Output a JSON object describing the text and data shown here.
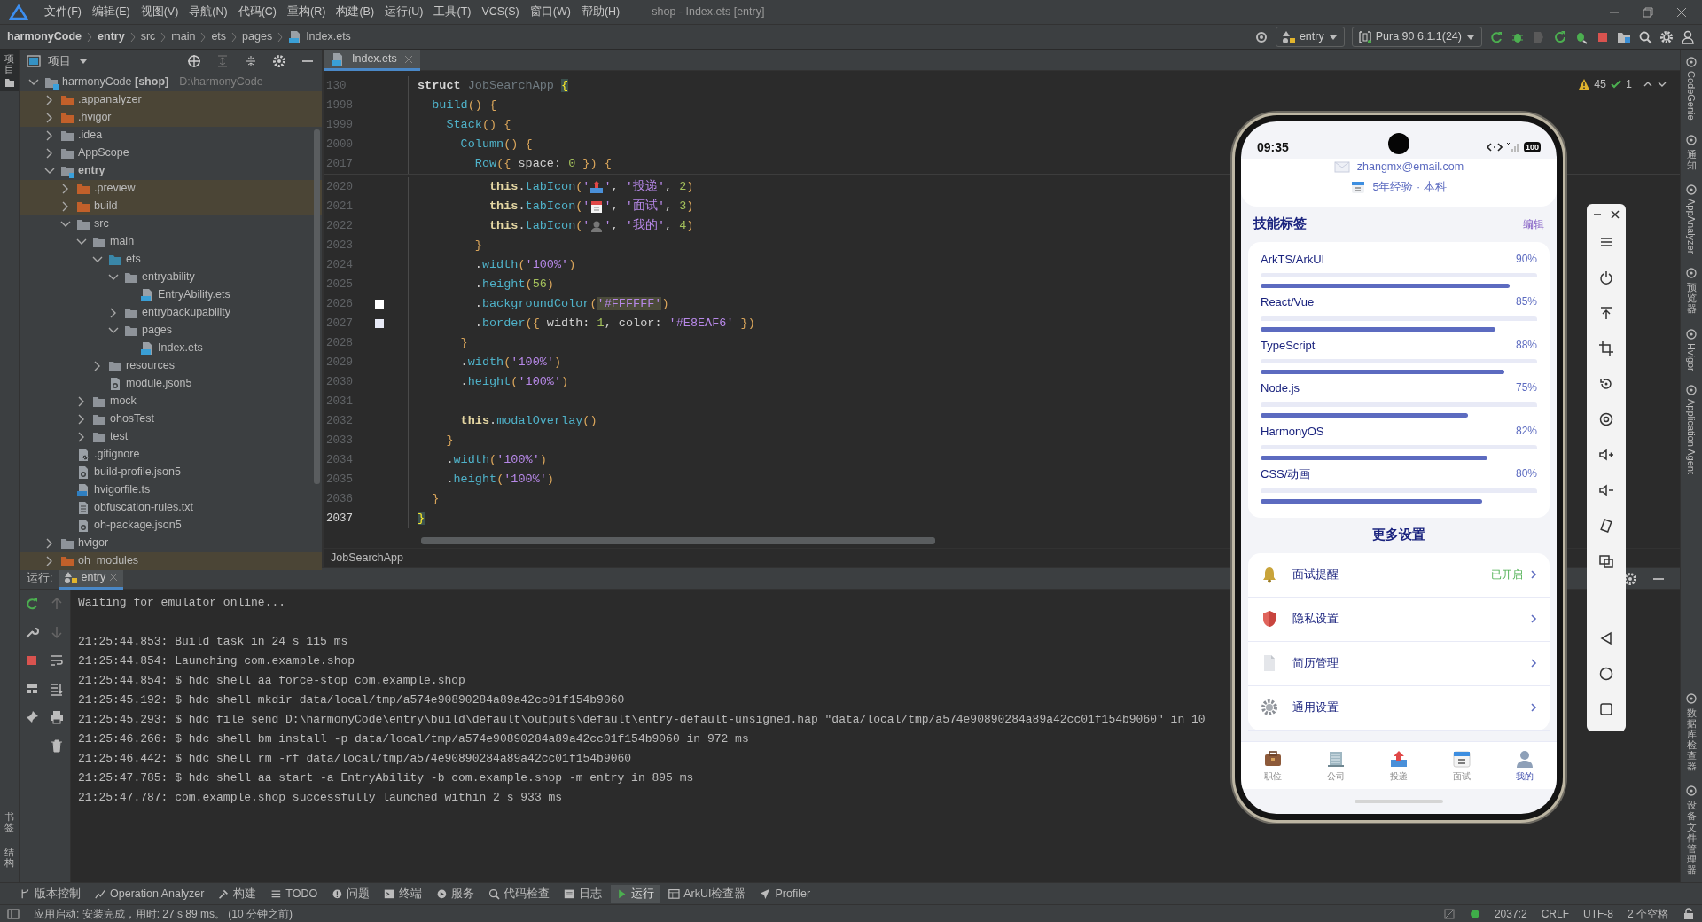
{
  "menu_bar": {
    "items": [
      "文件(F)",
      "编辑(E)",
      "视图(V)",
      "导航(N)",
      "代码(C)",
      "重构(R)",
      "构建(B)",
      "运行(U)",
      "工具(T)",
      "VCS(S)",
      "窗口(W)",
      "帮助(H)"
    ],
    "title": "shop - Index.ets [entry]"
  },
  "navigation_bar": {
    "breadcrumbs": [
      {
        "label": "harmonyCode",
        "kind": "module"
      },
      {
        "label": "entry",
        "kind": "module"
      },
      {
        "label": "src",
        "kind": "folder"
      },
      {
        "label": "main",
        "kind": "folder"
      },
      {
        "label": "ets",
        "kind": "folder"
      },
      {
        "label": "pages",
        "kind": "folder"
      },
      {
        "label": "Index.ets",
        "kind": "file"
      }
    ],
    "module_selector": "entry",
    "device_selector": "Pura 90 6.1.1(24)"
  },
  "left_strip": {
    "tabs": [
      {
        "label": "项目",
        "selected": true
      }
    ],
    "bottom": [
      "书签",
      "结构"
    ]
  },
  "project_panel": {
    "title": "项目",
    "tree": [
      {
        "label": "harmonyCode **[shop]**",
        "path": "D:\\harmonyCode",
        "kind": "root",
        "expanded": true,
        "children": [
          {
            "label": ".appanalyzer",
            "kind": "excluded",
            "expanded": false
          },
          {
            "label": ".hvigor",
            "kind": "excluded",
            "expanded": false
          },
          {
            "label": ".idea",
            "kind": "folder",
            "expanded": false
          },
          {
            "label": "AppScope",
            "kind": "folder",
            "expanded": false
          },
          {
            "label": "entry",
            "kind": "module",
            "expanded": true,
            "children": [
              {
                "label": ".preview",
                "kind": "excluded",
                "expanded": false
              },
              {
                "label": "build",
                "kind": "excluded",
                "expanded": false
              },
              {
                "label": "src",
                "kind": "folder",
                "expanded": true,
                "children": [
                  {
                    "label": "main",
                    "kind": "folder",
                    "expanded": true,
                    "children": [
                      {
                        "label": "ets",
                        "kind": "source",
                        "expanded": true,
                        "children": [
                          {
                            "label": "entryability",
                            "kind": "folder",
                            "expanded": true,
                            "children": [
                              {
                                "label": "EntryAbility.ets",
                                "kind": "file-ets"
                              }
                            ]
                          },
                          {
                            "label": "entrybackupability",
                            "kind": "folder",
                            "expanded": false
                          },
                          {
                            "label": "pages",
                            "kind": "folder",
                            "expanded": true,
                            "children": [
                              {
                                "label": "Index.ets",
                                "kind": "file-ets"
                              }
                            ]
                          }
                        ]
                      },
                      {
                        "label": "resources",
                        "kind": "folder",
                        "expanded": false
                      },
                      {
                        "label": "module.json5",
                        "kind": "file-json"
                      }
                    ]
                  },
                  {
                    "label": "mock",
                    "kind": "folder",
                    "expanded": false
                  },
                  {
                    "label": "ohosTest",
                    "kind": "folder",
                    "expanded": false
                  },
                  {
                    "label": "test",
                    "kind": "folder",
                    "expanded": false
                  }
                ]
              },
              {
                "label": ".gitignore",
                "kind": "file-ignore"
              },
              {
                "label": "build-profile.json5",
                "kind": "file-json"
              },
              {
                "label": "hvigorfile.ts",
                "kind": "file-ts"
              },
              {
                "label": "obfuscation-rules.txt",
                "kind": "file-txt"
              },
              {
                "label": "oh-package.json5",
                "kind": "file-json"
              }
            ]
          },
          {
            "label": "hvigor",
            "kind": "folder",
            "expanded": false
          },
          {
            "label": "oh_modules",
            "kind": "excluded",
            "expanded": false
          }
        ]
      }
    ]
  },
  "editor": {
    "tab": "Index.ets",
    "warnings": "45",
    "passed": "1",
    "sticky_lines": [
      {
        "number": "130",
        "segments": [
          {
            "text": "struct ",
            "kind": "kw"
          },
          {
            "text": "JobSearchApp ",
            "kind": "dim"
          },
          {
            "text": "{",
            "kind": "match"
          }
        ]
      },
      {
        "number": "1998",
        "segments": [
          {
            "text": "  build",
            "kind": "fn"
          },
          {
            "text": "() ",
            "kind": "par"
          },
          {
            "text": "{",
            "kind": "br"
          }
        ]
      },
      {
        "number": "1999",
        "segments": [
          {
            "text": "    Stack",
            "kind": "fn"
          },
          {
            "text": "() ",
            "kind": "par"
          },
          {
            "text": "{",
            "kind": "br"
          }
        ]
      },
      {
        "number": "2000",
        "segments": [
          {
            "text": "      Column",
            "kind": "fn"
          },
          {
            "text": "() ",
            "kind": "par"
          },
          {
            "text": "{",
            "kind": "br"
          }
        ]
      },
      {
        "number": "2017",
        "segments": [
          {
            "text": "        Row",
            "kind": "fn"
          },
          {
            "text": "(",
            "kind": "par"
          },
          {
            "text": "{",
            "kind": "br"
          },
          {
            "text": " space: ",
            "kind": "p"
          },
          {
            "text": "0",
            "kind": "num"
          },
          {
            "text": " }",
            "kind": "br"
          },
          {
            "text": ")",
            "kind": "par"
          },
          {
            "text": " {",
            "kind": "br"
          }
        ]
      }
    ],
    "lines": [
      {
        "number": "2020",
        "current": false,
        "segments": [
          {
            "text": "          this",
            "kind": "this"
          },
          {
            "text": ".",
            "kind": "p"
          },
          {
            "text": "tabIcon",
            "kind": "fn"
          },
          {
            "text": "(",
            "kind": "par"
          },
          {
            "text": "'",
            "kind": "str"
          },
          {
            "kind": "tray"
          },
          {
            "text": "'",
            "kind": "str"
          },
          {
            "text": ", ",
            "kind": "p"
          },
          {
            "text": "'投递'",
            "kind": "str"
          },
          {
            "text": ", ",
            "kind": "p"
          },
          {
            "text": "2",
            "kind": "num"
          },
          {
            "text": ")",
            "kind": "par"
          }
        ]
      },
      {
        "number": "2021",
        "current": false,
        "segments": [
          {
            "text": "          this",
            "kind": "this"
          },
          {
            "text": ".",
            "kind": "p"
          },
          {
            "text": "tabIcon",
            "kind": "fn"
          },
          {
            "text": "(",
            "kind": "par"
          },
          {
            "text": "'",
            "kind": "str"
          },
          {
            "kind": "calendar"
          },
          {
            "text": "'",
            "kind": "str"
          },
          {
            "text": ", ",
            "kind": "p"
          },
          {
            "text": "'面试'",
            "kind": "str"
          },
          {
            "text": ", ",
            "kind": "p"
          },
          {
            "text": "3",
            "kind": "num"
          },
          {
            "text": ")",
            "kind": "par"
          }
        ]
      },
      {
        "number": "2022",
        "current": false,
        "segments": [
          {
            "text": "          this",
            "kind": "this"
          },
          {
            "text": ".",
            "kind": "p"
          },
          {
            "text": "tabIcon",
            "kind": "fn"
          },
          {
            "text": "(",
            "kind": "par"
          },
          {
            "text": "'",
            "kind": "str"
          },
          {
            "kind": "person"
          },
          {
            "text": "'",
            "kind": "str"
          },
          {
            "text": ", ",
            "kind": "p"
          },
          {
            "text": "'我的'",
            "kind": "str"
          },
          {
            "text": ", ",
            "kind": "p"
          },
          {
            "text": "4",
            "kind": "num"
          },
          {
            "text": ")",
            "kind": "par"
          }
        ]
      },
      {
        "number": "2023",
        "current": false,
        "segments": [
          {
            "text": "        }",
            "kind": "br"
          }
        ]
      },
      {
        "number": "2024",
        "current": false,
        "segments": [
          {
            "text": "        .",
            "kind": "p"
          },
          {
            "text": "width",
            "kind": "fn"
          },
          {
            "text": "(",
            "kind": "par"
          },
          {
            "text": "'100%'",
            "kind": "str"
          },
          {
            "text": ")",
            "kind": "par"
          }
        ]
      },
      {
        "number": "2025",
        "current": false,
        "segments": [
          {
            "text": "        .",
            "kind": "p"
          },
          {
            "text": "height",
            "kind": "fn"
          },
          {
            "text": "(",
            "kind": "par"
          },
          {
            "text": "56",
            "kind": "num"
          },
          {
            "text": ")",
            "kind": "par"
          }
        ]
      },
      {
        "number": "2026",
        "current": false,
        "color": "#ffffff",
        "segments": [
          {
            "text": "        .",
            "kind": "p"
          },
          {
            "text": "backgroundColor",
            "kind": "fn"
          },
          {
            "text": "(",
            "kind": "par"
          },
          {
            "text": "'#FFFFFF'",
            "kind": "hl"
          },
          {
            "text": ")",
            "kind": "par"
          }
        ]
      },
      {
        "number": "2027",
        "current": false,
        "color": "#e8eaf6",
        "segments": [
          {
            "text": "        .",
            "kind": "p"
          },
          {
            "text": "border",
            "kind": "fn"
          },
          {
            "text": "(",
            "kind": "par"
          },
          {
            "text": "{",
            "kind": "br"
          },
          {
            "text": " width: ",
            "kind": "p"
          },
          {
            "text": "1",
            "kind": "num"
          },
          {
            "text": ", color: ",
            "kind": "p"
          },
          {
            "text": "'#E8EAF6'",
            "kind": "str"
          },
          {
            "text": " }",
            "kind": "br"
          },
          {
            "text": ")",
            "kind": "par"
          }
        ]
      },
      {
        "number": "2028",
        "current": false,
        "segments": [
          {
            "text": "      }",
            "kind": "br"
          }
        ]
      },
      {
        "number": "2029",
        "current": false,
        "segments": [
          {
            "text": "      .",
            "kind": "p"
          },
          {
            "text": "width",
            "kind": "fn"
          },
          {
            "text": "(",
            "kind": "par"
          },
          {
            "text": "'100%'",
            "kind": "str"
          },
          {
            "text": ")",
            "kind": "par"
          }
        ]
      },
      {
        "number": "2030",
        "current": false,
        "segments": [
          {
            "text": "      .",
            "kind": "p"
          },
          {
            "text": "height",
            "kind": "fn"
          },
          {
            "text": "(",
            "kind": "par"
          },
          {
            "text": "'100%'",
            "kind": "str"
          },
          {
            "text": ")",
            "kind": "par"
          }
        ]
      },
      {
        "number": "2031",
        "current": false
      },
      {
        "number": "2032",
        "current": false,
        "segments": [
          {
            "text": "      this",
            "kind": "this"
          },
          {
            "text": ".",
            "kind": "p"
          },
          {
            "text": "modalOverlay",
            "kind": "fn"
          },
          {
            "text": "()",
            "kind": "par"
          }
        ]
      },
      {
        "number": "2033",
        "current": false,
        "segments": [
          {
            "text": "    }",
            "kind": "br"
          }
        ]
      },
      {
        "number": "2034",
        "current": false,
        "segments": [
          {
            "text": "    .",
            "kind": "p"
          },
          {
            "text": "width",
            "kind": "fn"
          },
          {
            "text": "(",
            "kind": "par"
          },
          {
            "text": "'100%'",
            "kind": "str"
          },
          {
            "text": ")",
            "kind": "par"
          }
        ]
      },
      {
        "number": "2035",
        "current": false,
        "segments": [
          {
            "text": "    .",
            "kind": "p"
          },
          {
            "text": "height",
            "kind": "fn"
          },
          {
            "text": "(",
            "kind": "par"
          },
          {
            "text": "'100%'",
            "kind": "str"
          },
          {
            "text": ")",
            "kind": "par"
          }
        ]
      },
      {
        "number": "2036",
        "current": false,
        "segments": [
          {
            "text": "  }",
            "kind": "br"
          }
        ]
      },
      {
        "number": "2037",
        "current": true,
        "segments": [
          {
            "text": "}",
            "kind": "match"
          }
        ]
      }
    ],
    "breadcrumb": "JobSearchApp"
  },
  "run_panel": {
    "label": "运行:",
    "tab": "entry",
    "log": [
      {
        "kind": "status",
        "text": "Waiting for emulator online..."
      },
      {
        "kind": "step",
        "text": "21:25:44.853: Build task in 24 s 115 ms"
      },
      {
        "kind": "step",
        "text": "21:25:44.854: Launching com.example.shop"
      },
      {
        "kind": "step",
        "text": "21:25:44.854: $ hdc shell aa force-stop com.example.shop"
      },
      {
        "kind": "step",
        "text": "21:25:45.192: $ hdc shell mkdir data/local/tmp/a574e90890284a89a42cc01f154b9060"
      },
      {
        "kind": "step",
        "text": "21:25:45.293: $ hdc file send D:\\harmonyCode\\entry\\build\\default\\outputs\\default\\entry-default-unsigned.hap \"data/local/tmp/a574e90890284a89a42cc01f154b9060\" in 10"
      },
      {
        "kind": "step",
        "text": "21:25:46.266: $ hdc shell bm install -p data/local/tmp/a574e90890284a89a42cc01f154b9060 in 972 ms"
      },
      {
        "kind": "step",
        "text": "21:25:46.442: $ hdc shell rm -rf data/local/tmp/a574e90890284a89a42cc01f154b9060"
      },
      {
        "kind": "step",
        "text": "21:25:47.785: $ hdc shell aa start -a EntryAbility -b com.example.shop -m entry in 895 ms"
      },
      {
        "kind": "step",
        "text": "21:25:47.787: com.example.shop successfully launched within 2 s 933 ms"
      }
    ]
  },
  "emulator": {
    "status_bar": {
      "time": "09:35",
      "battery": "100"
    },
    "profile": {
      "email": "zhangmx@email.com",
      "experience": "5年经验 · 本科"
    },
    "skills": {
      "title": "技能标签",
      "action": "编辑",
      "items": [
        {
          "name": "ArkTS/ArkUI",
          "reading": "90%",
          "level": 0.9
        },
        {
          "name": "React/Vue",
          "reading": "85%",
          "level": 0.85
        },
        {
          "name": "TypeScript",
          "reading": "88%",
          "level": 0.88
        },
        {
          "name": "Node.js",
          "reading": "75%",
          "level": 0.75
        },
        {
          "name": "HarmonyOS",
          "reading": "82%",
          "level": 0.82
        },
        {
          "name": "CSS/动画",
          "reading": "80%",
          "level": 0.8
        }
      ]
    },
    "settings": {
      "title": "更多设置",
      "items": [
        {
          "label": "面试提醒",
          "kind": "bell",
          "status": "已开启"
        },
        {
          "label": "隐私设置",
          "kind": "shield"
        },
        {
          "label": "简历管理",
          "kind": "document"
        },
        {
          "label": "通用设置",
          "kind": "gear"
        }
      ]
    },
    "tab_bar": [
      {
        "label": "职位",
        "kind": "briefcase",
        "selected": false
      },
      {
        "label": "公司",
        "kind": "building",
        "selected": false
      },
      {
        "label": "投递",
        "kind": "tray",
        "selected": false
      },
      {
        "label": "面试",
        "kind": "calendar",
        "selected": false
      },
      {
        "label": "我的",
        "kind": "person",
        "selected": true
      }
    ]
  },
  "right_strip": {
    "top": [
      {
        "label": "CodeGenie",
        "kind": "rotated"
      },
      {
        "label": "通知",
        "kind": "stacked"
      },
      {
        "label": "AppAnalyzer",
        "kind": "rotated"
      },
      {
        "label": "预览器",
        "kind": "stacked"
      },
      {
        "label": "Hvigor",
        "kind": "rotated"
      },
      {
        "label": "Application Agent",
        "kind": "rotated"
      }
    ],
    "bottom": [
      {
        "label": "数据库检查器",
        "kind": "stacked"
      },
      {
        "label": "设备文件管理器",
        "kind": "stacked"
      }
    ]
  },
  "tool_tabs": [
    {
      "label": "版本控制",
      "selected": false
    },
    {
      "label": "Operation Analyzer",
      "selected": false
    },
    {
      "label": "构建",
      "selected": false
    },
    {
      "label": "TODO",
      "selected": false
    },
    {
      "label": "问题",
      "selected": false
    },
    {
      "label": "终端",
      "selected": false
    },
    {
      "label": "服务",
      "selected": false
    },
    {
      "label": "代码检查",
      "selected": false
    },
    {
      "label": "日志",
      "selected": false
    },
    {
      "label": "运行",
      "selected": true
    },
    {
      "label": "ArkUI检查器",
      "selected": false
    },
    {
      "label": "Profiler",
      "selected": false
    }
  ],
  "status_bar": {
    "message": "应用启动: 安装完成，用时: 27 s 89 ms。 (10 分钟之前)",
    "items": [
      "2037:2",
      "CRLF",
      "UTF-8",
      "2 个空格"
    ]
  }
}
